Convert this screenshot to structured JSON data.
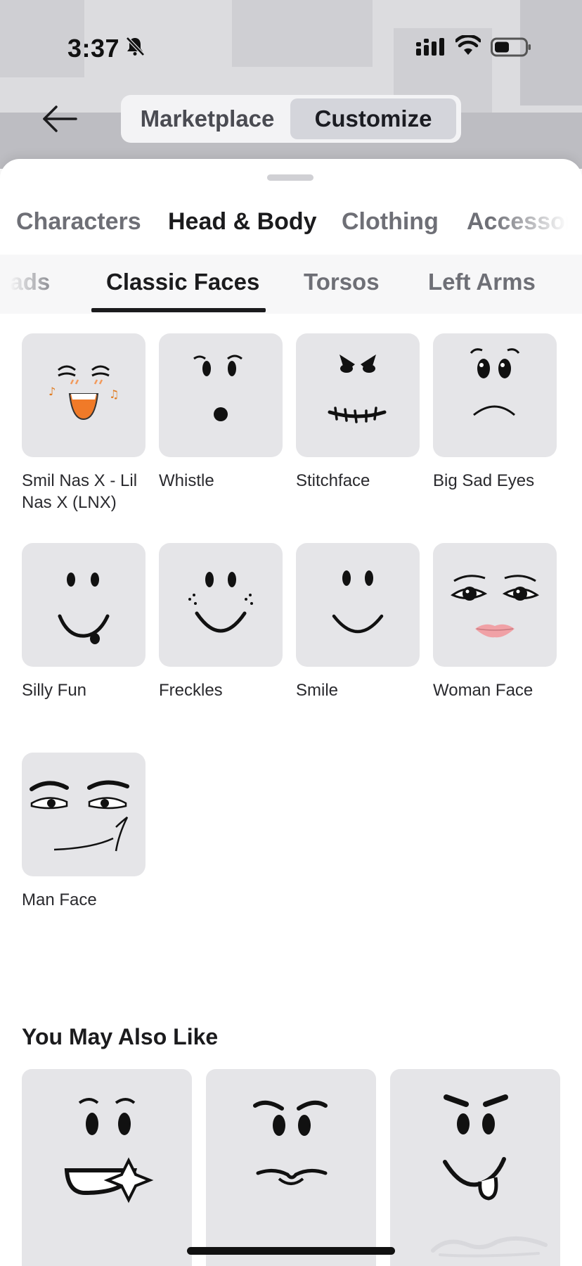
{
  "status_bar": {
    "time": "3:37",
    "icons": [
      "bell-slash-icon",
      "cellular-signal-icon",
      "wifi-icon",
      "battery-icon"
    ]
  },
  "header": {
    "back_icon": "arrow-left-icon",
    "segments": [
      {
        "label": "Marketplace",
        "selected": false
      },
      {
        "label": "Customize",
        "selected": true
      }
    ]
  },
  "category_tabs": [
    {
      "label": "Characters",
      "selected": false
    },
    {
      "label": "Head & Body",
      "selected": true
    },
    {
      "label": "Clothing",
      "selected": false
    },
    {
      "label": "Accessorie",
      "selected": false
    }
  ],
  "subcategory_tabs": [
    {
      "label": "eads",
      "selected": false
    },
    {
      "label": "Classic Faces",
      "selected": true
    },
    {
      "label": "Torsos",
      "selected": false
    },
    {
      "label": "Left Arms",
      "selected": false
    }
  ],
  "faces": [
    {
      "name": "Smil Nas X - Lil Nas X (LNX)",
      "icon": "lil-nas-x-face-icon"
    },
    {
      "name": "Whistle",
      "icon": "whistle-face-icon"
    },
    {
      "name": "Stitchface",
      "icon": "stitchface-icon"
    },
    {
      "name": "Big Sad Eyes",
      "icon": "big-sad-eyes-face-icon"
    },
    {
      "name": "Silly Fun",
      "icon": "silly-fun-face-icon"
    },
    {
      "name": "Freckles",
      "icon": "freckles-face-icon"
    },
    {
      "name": "Smile",
      "icon": "smile-face-icon"
    },
    {
      "name": "Woman Face",
      "icon": "woman-face-icon"
    },
    {
      "name": "Man Face",
      "icon": "man-face-icon"
    }
  ],
  "recommendations": {
    "title": "You May Also Like",
    "items": [
      {
        "icon": "grin-face-icon"
      },
      {
        "icon": "mustache-face-icon"
      },
      {
        "icon": "tongue-face-icon"
      }
    ]
  },
  "colors": {
    "accent": "#1b1b1d",
    "tile": "#e5e5e8",
    "secondary_text": "#6e6f76"
  }
}
